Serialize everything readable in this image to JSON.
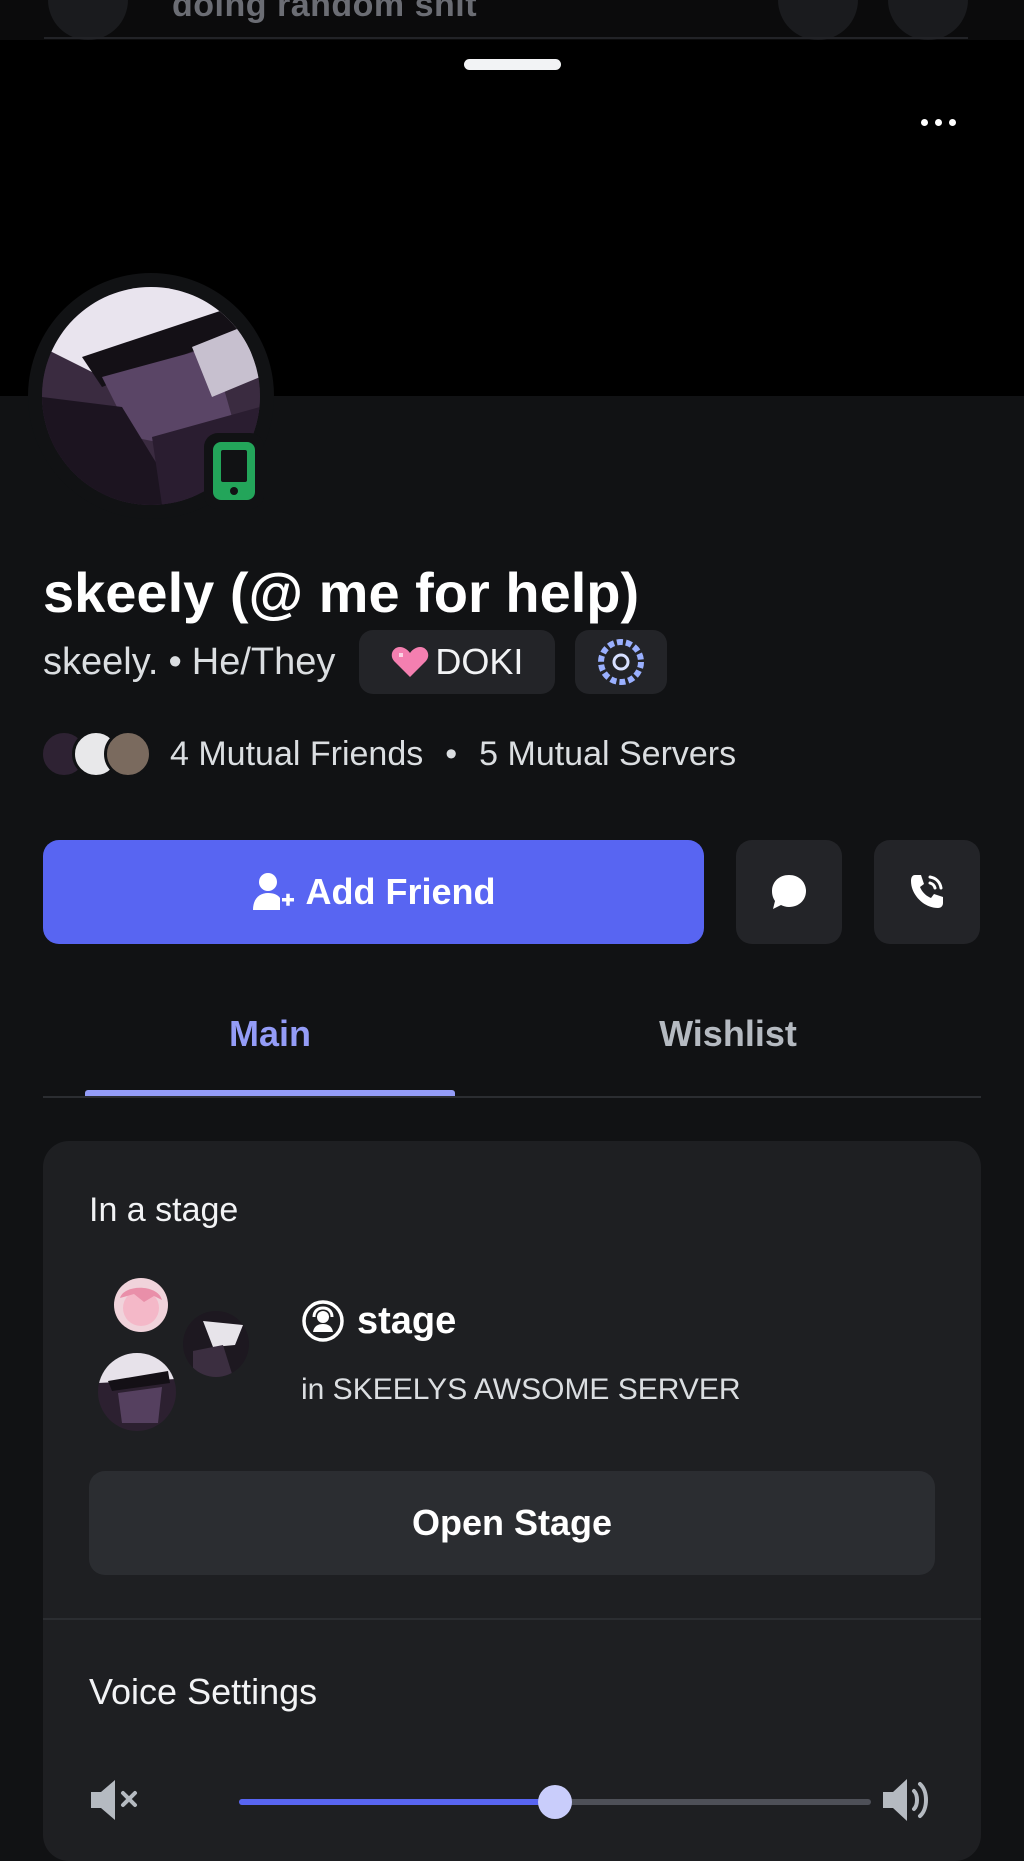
{
  "background_sheet": {
    "title": "doing random shit"
  },
  "header": {
    "more_label": "More options"
  },
  "profile": {
    "display_name": "skeely (@ me for help)",
    "username": "skeely.",
    "separator": "•",
    "pronouns": "He/They",
    "server_tag": "DOKI",
    "status": "mobile-online",
    "mutual_friends": "4 Mutual Friends",
    "mutual_separator": "•",
    "mutual_servers": "5 Mutual Servers"
  },
  "actions": {
    "add_friend_label": "Add Friend",
    "message_icon": "chat-bubble-icon",
    "call_icon": "phone-call-icon"
  },
  "tabs": [
    {
      "label": "Main",
      "active": true
    },
    {
      "label": "Wishlist",
      "active": false
    }
  ],
  "activity": {
    "heading": "In a stage",
    "stage_name": "stage",
    "server_line": "in SKEELYS AWSOME SERVER",
    "open_button": "Open Stage"
  },
  "voice": {
    "heading": "Voice Settings",
    "volume_fraction": 0.5
  },
  "colors": {
    "accent": "#5865f2",
    "tab_active": "#949cf7",
    "background": "#111214",
    "card": "#1e1f22",
    "online_mobile": "#23a55a"
  }
}
